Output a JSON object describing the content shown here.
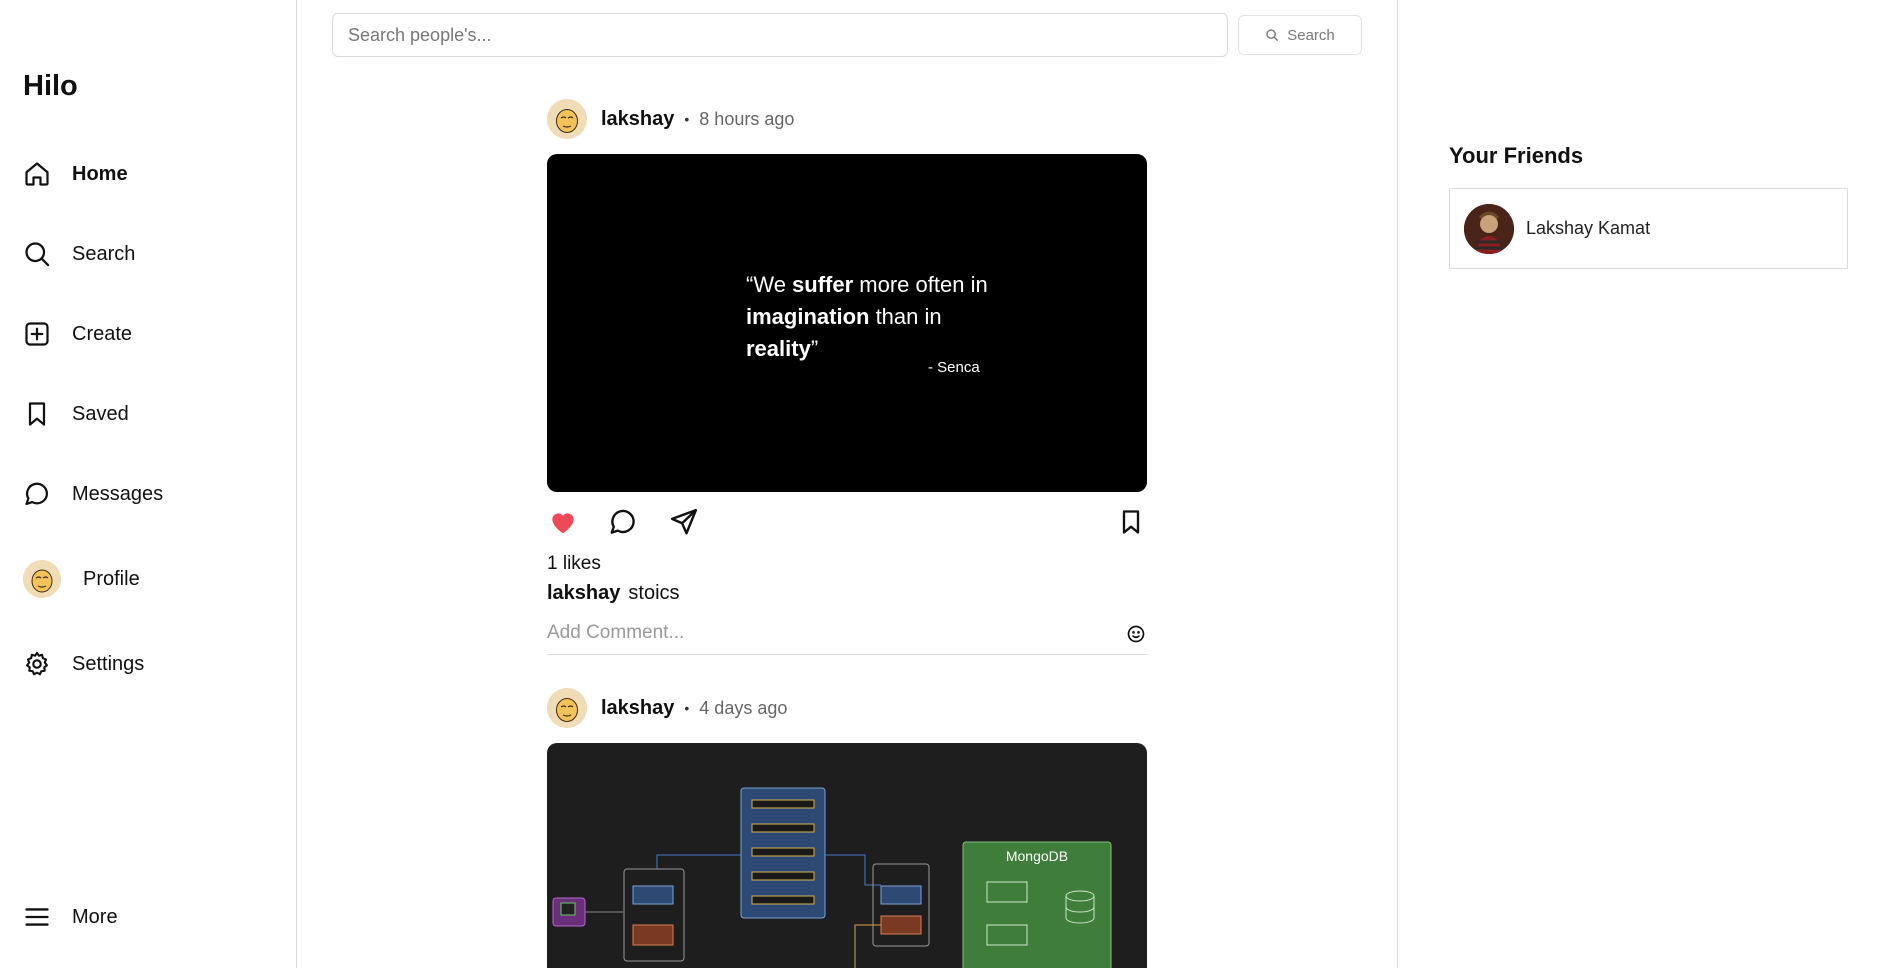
{
  "app": {
    "name": "Hilo"
  },
  "sidebar": {
    "items": [
      {
        "label": "Home",
        "icon": "home-icon",
        "active": true
      },
      {
        "label": "Search",
        "icon": "search-icon"
      },
      {
        "label": "Create",
        "icon": "plus-square-icon"
      },
      {
        "label": "Saved",
        "icon": "bookmark-icon"
      },
      {
        "label": "Messages",
        "icon": "chat-bubble-icon"
      },
      {
        "label": "Profile",
        "icon": "avatar"
      },
      {
        "label": "Settings",
        "icon": "gear-icon"
      }
    ],
    "more": {
      "label": "More",
      "icon": "menu-icon"
    }
  },
  "search": {
    "placeholder": "Search people's...",
    "button_label": "Search"
  },
  "feed": {
    "posts": [
      {
        "username": "lakshay",
        "separator": "•",
        "time": "8 hours ago",
        "quote": {
          "p1": "“We ",
          "b1": "suffer",
          "p2": " more often in ",
          "b2": "imagination",
          "p3": " than in ",
          "b3": "reality",
          "p4": "”"
        },
        "quote_author": "- Senca",
        "likes": "1 likes",
        "caption_user": "lakshay",
        "caption_text": "stoics",
        "comment_placeholder": "Add Comment...",
        "liked": true
      },
      {
        "username": "lakshay",
        "separator": "•",
        "time": "4 days ago",
        "diagram": {
          "db_label": "MongoDB",
          "accent_blue": "#2c4a73",
          "accent_green": "#3f7d3a",
          "accent_purple": "#6b2f7a",
          "accent_brown": "#7a3a22"
        }
      }
    ]
  },
  "friends": {
    "title": "Your Friends",
    "list": [
      {
        "name": "Lakshay Kamat"
      }
    ]
  },
  "colors": {
    "like_red": "#ed4956",
    "border": "#dbdbdb",
    "muted_text": "#666666"
  }
}
